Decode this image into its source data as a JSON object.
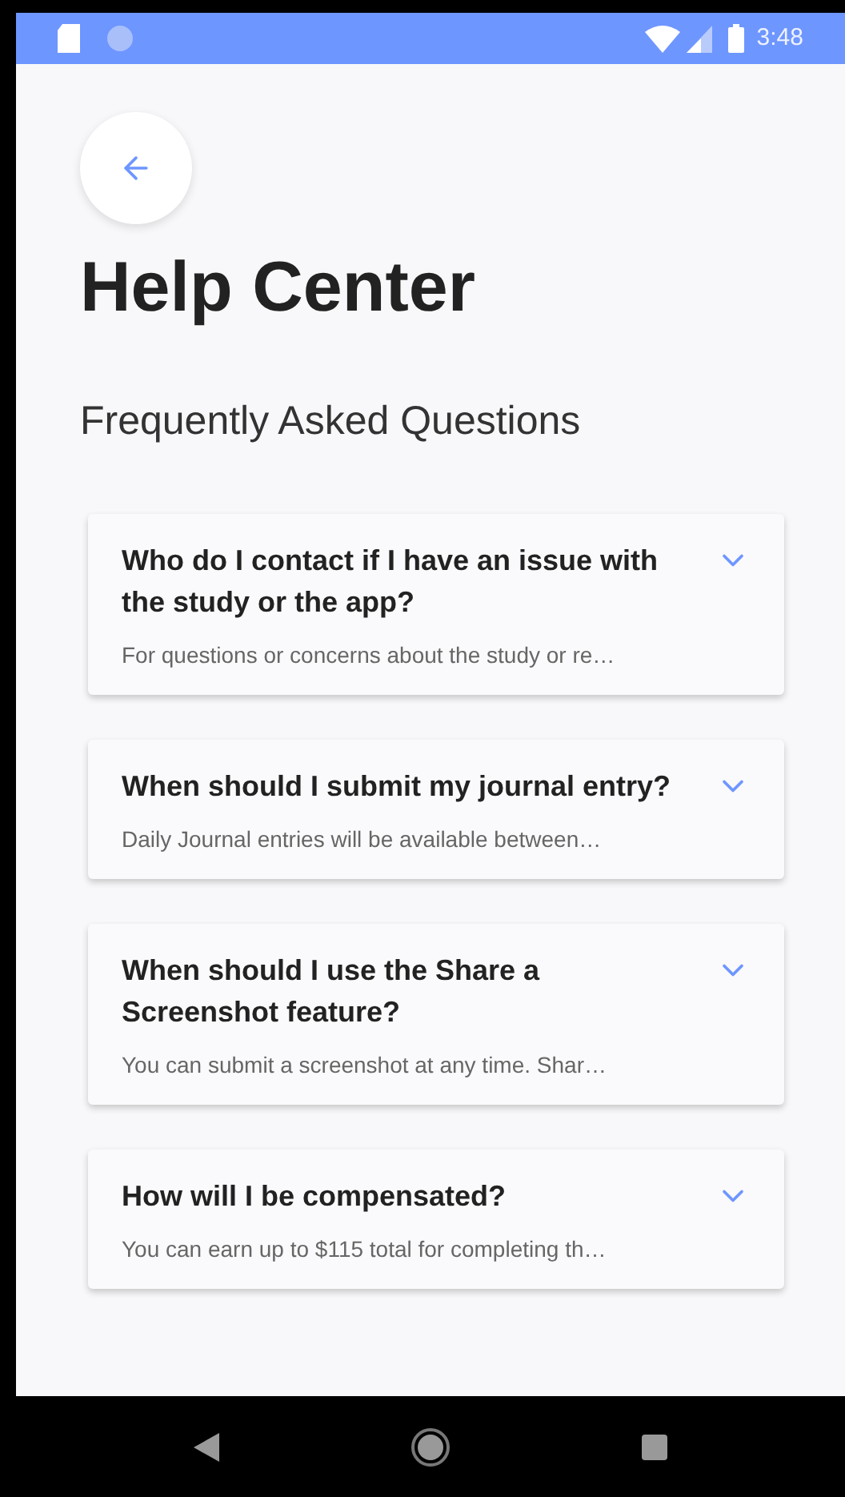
{
  "status_bar": {
    "time": "3:48"
  },
  "title": "Help Center",
  "section_title": "Frequently Asked Questions",
  "faqs": [
    {
      "question": "Who do I contact if I have an issue with the study or the app?",
      "summary": "For questions or concerns about the study or re…",
      "expanded": false
    },
    {
      "question": "When should I submit my journal entry?",
      "summary": "Daily Journal entries will be available between…",
      "expanded": false
    },
    {
      "question": "When should I use the Share a Screenshot feature?",
      "summary": "You can submit a screenshot at any time. Shar…",
      "expanded": false
    },
    {
      "question": "How will I be compensated?",
      "summary": "You can earn up to $115 total for completing th…",
      "expanded": false
    }
  ]
}
